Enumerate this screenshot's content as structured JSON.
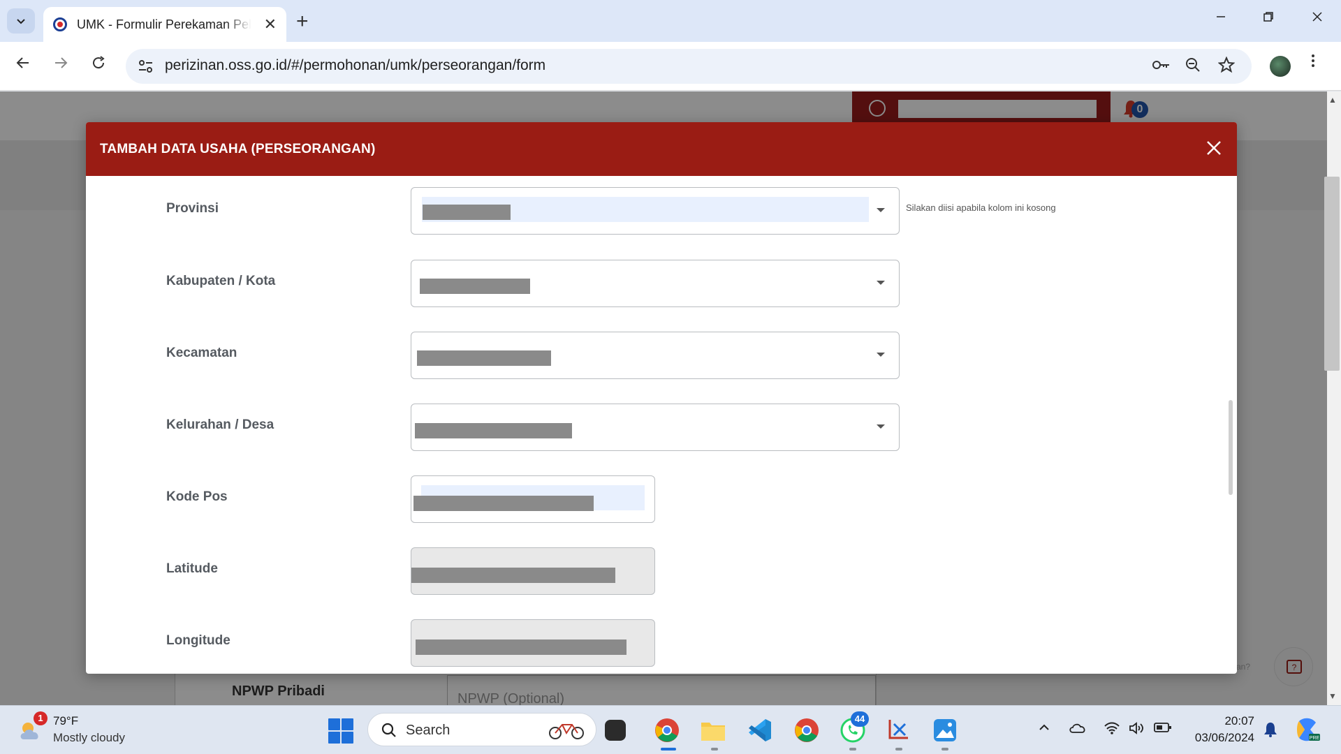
{
  "browser": {
    "tab_title": "UMK - Formulir Perekaman Pelaku",
    "url": "perizinan.oss.go.id/#/permohonan/umk/perseorangan/form",
    "new_tab": "+",
    "close_tab": "✕"
  },
  "page": {
    "notification_count": "0",
    "npwp_label": "NPWP Pribadi",
    "npwp_placeholder": "NPWP (Optional)",
    "help_text": "an?"
  },
  "modal": {
    "title": "TAMBAH DATA USAHA (PERSEORANGAN)",
    "hint": "Silakan diisi apabila kolom ini kosong",
    "fields": [
      {
        "label": "Provinsi",
        "type": "select"
      },
      {
        "label": "Kabupaten / Kota",
        "type": "select"
      },
      {
        "label": "Kecamatan",
        "type": "select"
      },
      {
        "label": "Kelurahan / Desa",
        "type": "select"
      },
      {
        "label": "Kode Pos",
        "type": "text"
      },
      {
        "label": "Latitude",
        "type": "readonly"
      },
      {
        "label": "Longitude",
        "type": "readonly"
      }
    ]
  },
  "taskbar": {
    "weather_temp": "79°F",
    "weather_desc": "Mostly cloudy",
    "weather_badge": "1",
    "search_label": "Search",
    "whatsapp_badge": "44",
    "time": "20:07",
    "date": "03/06/2024"
  },
  "colors": {
    "modal_header": "#9a1c14",
    "accent_blue": "#1e6fd9"
  }
}
